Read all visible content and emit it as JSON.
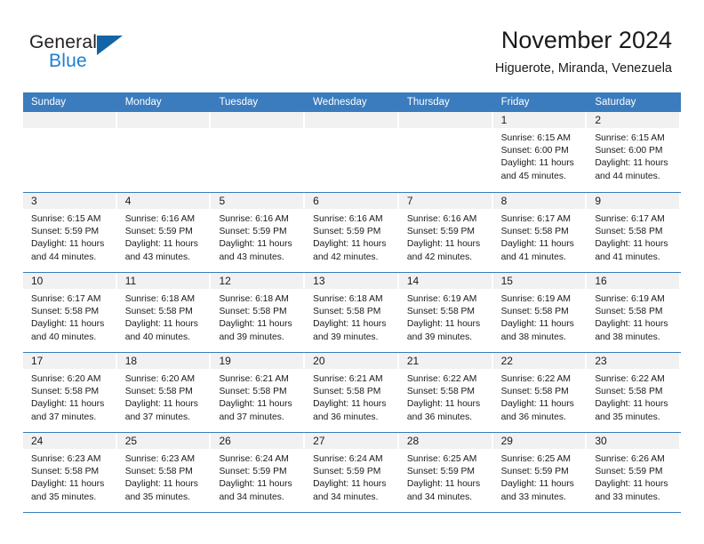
{
  "brand": {
    "name_part1": "General",
    "name_part2": "Blue"
  },
  "header": {
    "title": "November 2024",
    "subtitle": "Higuerote, Miranda, Venezuela"
  },
  "colors": {
    "header_blue": "#3a7cbe",
    "band_gray": "#f1f1f1",
    "logo_blue": "#1c7fd4",
    "logo_triangle": "#1364a6"
  },
  "weekdays": [
    "Sunday",
    "Monday",
    "Tuesday",
    "Wednesday",
    "Thursday",
    "Friday",
    "Saturday"
  ],
  "weeks": [
    [
      {
        "day": "",
        "lines": []
      },
      {
        "day": "",
        "lines": []
      },
      {
        "day": "",
        "lines": []
      },
      {
        "day": "",
        "lines": []
      },
      {
        "day": "",
        "lines": []
      },
      {
        "day": "1",
        "lines": [
          "Sunrise: 6:15 AM",
          "Sunset: 6:00 PM",
          "Daylight: 11 hours",
          "and 45 minutes."
        ]
      },
      {
        "day": "2",
        "lines": [
          "Sunrise: 6:15 AM",
          "Sunset: 6:00 PM",
          "Daylight: 11 hours",
          "and 44 minutes."
        ]
      }
    ],
    [
      {
        "day": "3",
        "lines": [
          "Sunrise: 6:15 AM",
          "Sunset: 5:59 PM",
          "Daylight: 11 hours",
          "and 44 minutes."
        ]
      },
      {
        "day": "4",
        "lines": [
          "Sunrise: 6:16 AM",
          "Sunset: 5:59 PM",
          "Daylight: 11 hours",
          "and 43 minutes."
        ]
      },
      {
        "day": "5",
        "lines": [
          "Sunrise: 6:16 AM",
          "Sunset: 5:59 PM",
          "Daylight: 11 hours",
          "and 43 minutes."
        ]
      },
      {
        "day": "6",
        "lines": [
          "Sunrise: 6:16 AM",
          "Sunset: 5:59 PM",
          "Daylight: 11 hours",
          "and 42 minutes."
        ]
      },
      {
        "day": "7",
        "lines": [
          "Sunrise: 6:16 AM",
          "Sunset: 5:59 PM",
          "Daylight: 11 hours",
          "and 42 minutes."
        ]
      },
      {
        "day": "8",
        "lines": [
          "Sunrise: 6:17 AM",
          "Sunset: 5:58 PM",
          "Daylight: 11 hours",
          "and 41 minutes."
        ]
      },
      {
        "day": "9",
        "lines": [
          "Sunrise: 6:17 AM",
          "Sunset: 5:58 PM",
          "Daylight: 11 hours",
          "and 41 minutes."
        ]
      }
    ],
    [
      {
        "day": "10",
        "lines": [
          "Sunrise: 6:17 AM",
          "Sunset: 5:58 PM",
          "Daylight: 11 hours",
          "and 40 minutes."
        ]
      },
      {
        "day": "11",
        "lines": [
          "Sunrise: 6:18 AM",
          "Sunset: 5:58 PM",
          "Daylight: 11 hours",
          "and 40 minutes."
        ]
      },
      {
        "day": "12",
        "lines": [
          "Sunrise: 6:18 AM",
          "Sunset: 5:58 PM",
          "Daylight: 11 hours",
          "and 39 minutes."
        ]
      },
      {
        "day": "13",
        "lines": [
          "Sunrise: 6:18 AM",
          "Sunset: 5:58 PM",
          "Daylight: 11 hours",
          "and 39 minutes."
        ]
      },
      {
        "day": "14",
        "lines": [
          "Sunrise: 6:19 AM",
          "Sunset: 5:58 PM",
          "Daylight: 11 hours",
          "and 39 minutes."
        ]
      },
      {
        "day": "15",
        "lines": [
          "Sunrise: 6:19 AM",
          "Sunset: 5:58 PM",
          "Daylight: 11 hours",
          "and 38 minutes."
        ]
      },
      {
        "day": "16",
        "lines": [
          "Sunrise: 6:19 AM",
          "Sunset: 5:58 PM",
          "Daylight: 11 hours",
          "and 38 minutes."
        ]
      }
    ],
    [
      {
        "day": "17",
        "lines": [
          "Sunrise: 6:20 AM",
          "Sunset: 5:58 PM",
          "Daylight: 11 hours",
          "and 37 minutes."
        ]
      },
      {
        "day": "18",
        "lines": [
          "Sunrise: 6:20 AM",
          "Sunset: 5:58 PM",
          "Daylight: 11 hours",
          "and 37 minutes."
        ]
      },
      {
        "day": "19",
        "lines": [
          "Sunrise: 6:21 AM",
          "Sunset: 5:58 PM",
          "Daylight: 11 hours",
          "and 37 minutes."
        ]
      },
      {
        "day": "20",
        "lines": [
          "Sunrise: 6:21 AM",
          "Sunset: 5:58 PM",
          "Daylight: 11 hours",
          "and 36 minutes."
        ]
      },
      {
        "day": "21",
        "lines": [
          "Sunrise: 6:22 AM",
          "Sunset: 5:58 PM",
          "Daylight: 11 hours",
          "and 36 minutes."
        ]
      },
      {
        "day": "22",
        "lines": [
          "Sunrise: 6:22 AM",
          "Sunset: 5:58 PM",
          "Daylight: 11 hours",
          "and 36 minutes."
        ]
      },
      {
        "day": "23",
        "lines": [
          "Sunrise: 6:22 AM",
          "Sunset: 5:58 PM",
          "Daylight: 11 hours",
          "and 35 minutes."
        ]
      }
    ],
    [
      {
        "day": "24",
        "lines": [
          "Sunrise: 6:23 AM",
          "Sunset: 5:58 PM",
          "Daylight: 11 hours",
          "and 35 minutes."
        ]
      },
      {
        "day": "25",
        "lines": [
          "Sunrise: 6:23 AM",
          "Sunset: 5:58 PM",
          "Daylight: 11 hours",
          "and 35 minutes."
        ]
      },
      {
        "day": "26",
        "lines": [
          "Sunrise: 6:24 AM",
          "Sunset: 5:59 PM",
          "Daylight: 11 hours",
          "and 34 minutes."
        ]
      },
      {
        "day": "27",
        "lines": [
          "Sunrise: 6:24 AM",
          "Sunset: 5:59 PM",
          "Daylight: 11 hours",
          "and 34 minutes."
        ]
      },
      {
        "day": "28",
        "lines": [
          "Sunrise: 6:25 AM",
          "Sunset: 5:59 PM",
          "Daylight: 11 hours",
          "and 34 minutes."
        ]
      },
      {
        "day": "29",
        "lines": [
          "Sunrise: 6:25 AM",
          "Sunset: 5:59 PM",
          "Daylight: 11 hours",
          "and 33 minutes."
        ]
      },
      {
        "day": "30",
        "lines": [
          "Sunrise: 6:26 AM",
          "Sunset: 5:59 PM",
          "Daylight: 11 hours",
          "and 33 minutes."
        ]
      }
    ]
  ]
}
